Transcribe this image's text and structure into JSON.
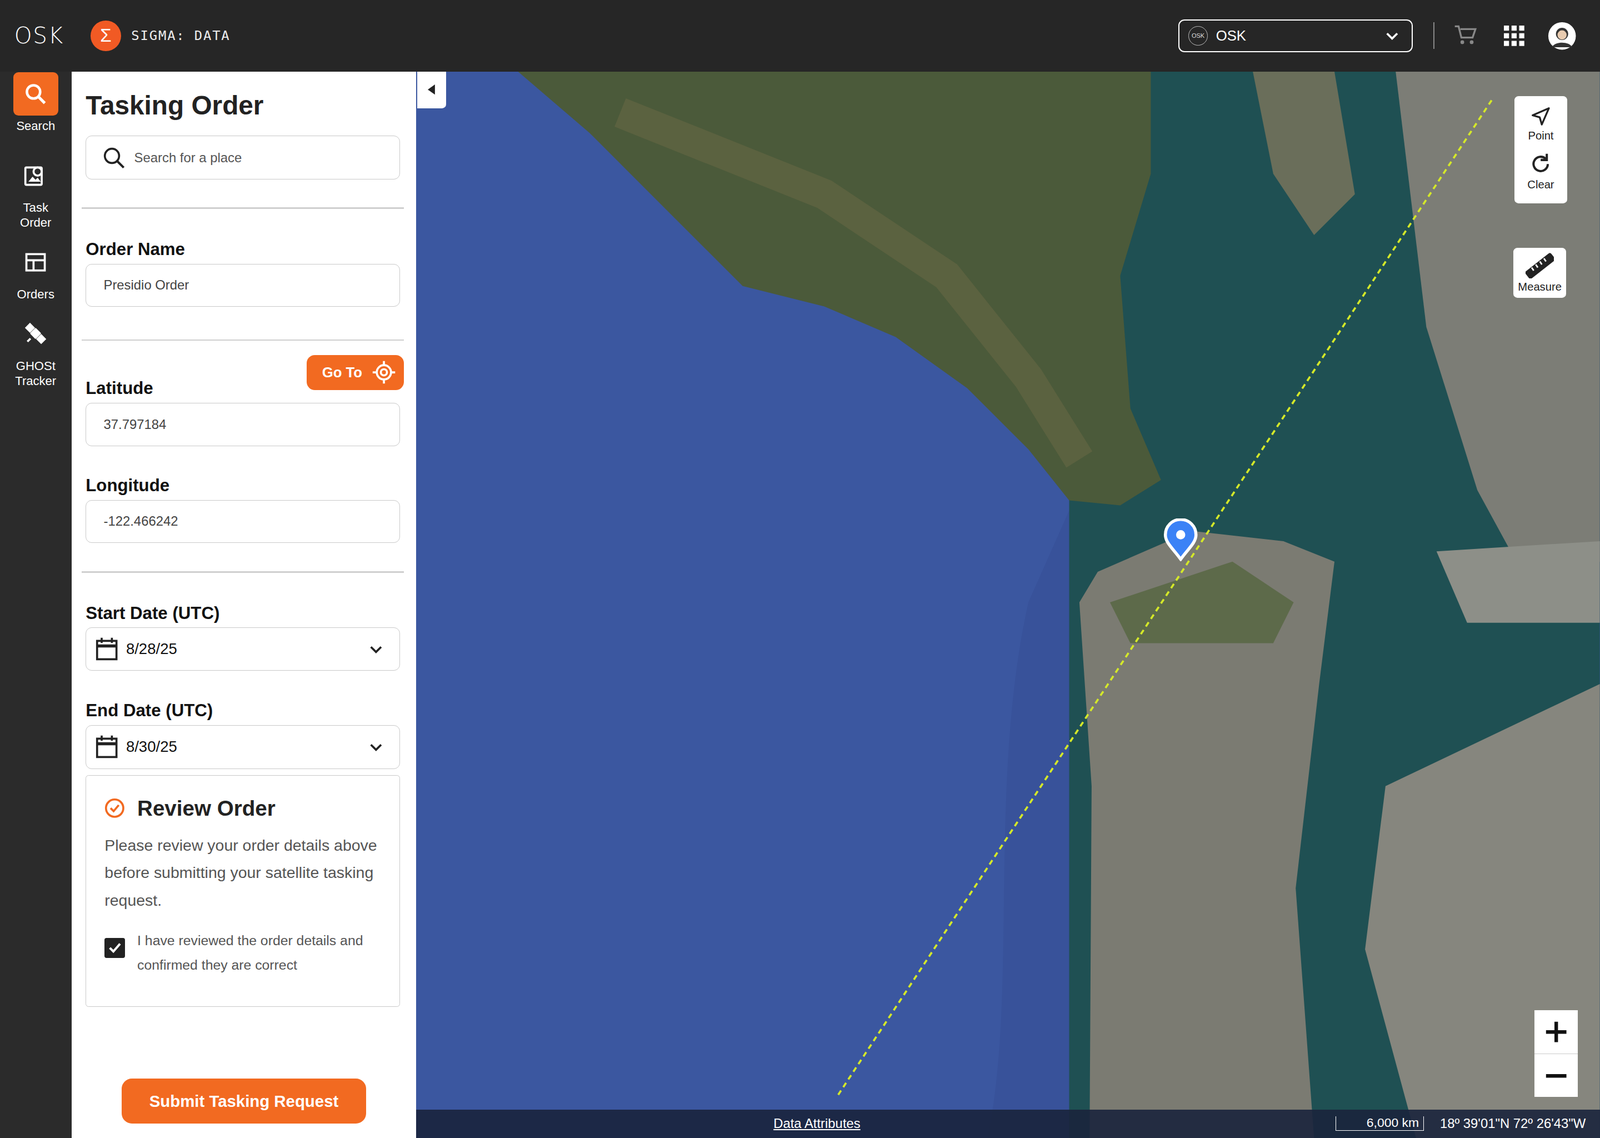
{
  "header": {
    "logo": "OSK",
    "app_icon": "Σ",
    "app_title": "SIGMA: DATA",
    "org": {
      "badge": "OSK",
      "label": "OSK"
    }
  },
  "nav": [
    {
      "label": "Search",
      "selected": true
    },
    {
      "label": "Task Order",
      "selected": false
    },
    {
      "label": "Orders",
      "selected": false
    },
    {
      "label": "GHOSt Tracker",
      "selected": false
    }
  ],
  "form": {
    "title": "Tasking Order",
    "search": {
      "placeholder": "Search for a place"
    },
    "order_name": {
      "label": "Order Name",
      "value": "Presidio Order"
    },
    "go_to": "Go To",
    "latitude": {
      "label": "Latitude",
      "value": "37.797184"
    },
    "longitude": {
      "label": "Longitude",
      "value": "-122.466242"
    },
    "start_date": {
      "label": "Start Date (UTC)",
      "value": "8/28/25"
    },
    "end_date": {
      "label": "End Date (UTC)",
      "value": "8/30/25"
    }
  },
  "review": {
    "title": "Review Order",
    "text": "Please review your order details above before submitting your satellite tasking request.",
    "confirm": {
      "label": "I have reviewed the order details and confirmed they are correct",
      "checked": true
    }
  },
  "submit": "Submit Tasking Request",
  "map": {
    "tools": [
      {
        "label": "Point"
      },
      {
        "label": "Clear"
      }
    ],
    "measure": "Measure",
    "footer": {
      "attribution": "Data Attributes",
      "scale": "6,000 km",
      "coordinates": "18º 39'01\"N 72º 26'43\"W"
    }
  }
}
